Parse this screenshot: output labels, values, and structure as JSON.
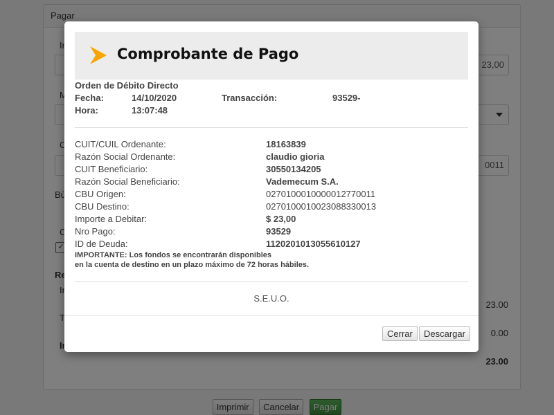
{
  "background": {
    "panel_title": "Pagar",
    "label_fragments": [
      "In",
      "M",
      "C",
      "Bú",
      "C",
      "Re",
      "In",
      "T",
      "In"
    ],
    "input_values": [
      "23,00",
      "",
      "0011"
    ],
    "summary_values": [
      "23.00",
      "0.00",
      "23.00"
    ],
    "buttons": {
      "print": "Imprimir",
      "cancel": "Cancelar",
      "pay": "Pagar"
    }
  },
  "modal": {
    "title": "Comprobante de Pago",
    "order_type": "Orden de Débito Directo",
    "date_label": "Fecha:",
    "date_value": "14/10/2020",
    "transaction_label": "Transacción:",
    "transaction_value": "93529-",
    "time_label": "Hora:",
    "time_value": "13:07:48",
    "details": [
      {
        "label": "CUIT/CUIL Ordenante:",
        "value": "18163839",
        "bold": true
      },
      {
        "label": "Razón Social Ordenante:",
        "value": "claudio gioria",
        "bold": true
      },
      {
        "label": "CUIT Beneficiario:",
        "value": "30550134205",
        "bold": true
      },
      {
        "label": "Razón Social Beneficiario:",
        "value": "Vademecum S.A.",
        "bold": true
      },
      {
        "label": "CBU Origen:",
        "value": "0270100010000012770011",
        "bold": false
      },
      {
        "label": "CBU Destino:",
        "value": "0270100010023088330013",
        "bold": false
      },
      {
        "label": "Importe a Debitar:",
        "value": "$ 23,00",
        "bold": true
      },
      {
        "label": "Nro Pago:",
        "value": "93529",
        "bold": true
      },
      {
        "label": "ID de Deuda:",
        "value": "1120201013055610127",
        "bold": true
      }
    ],
    "notice_line1": "IMPORTANTE: Los fondos se encontrarán disponibles",
    "notice_line2": "en la cuenta de destino en un plazo máximo de 72 horas hábiles.",
    "footer_text": "S.E.U.O.",
    "close_button": "Cerrar",
    "download_button": "Descargar"
  },
  "colors": {
    "accent_arrow": "#f7a600",
    "pay_button": "#449d44",
    "overlay": "rgba(0,0,0,0.5)"
  }
}
